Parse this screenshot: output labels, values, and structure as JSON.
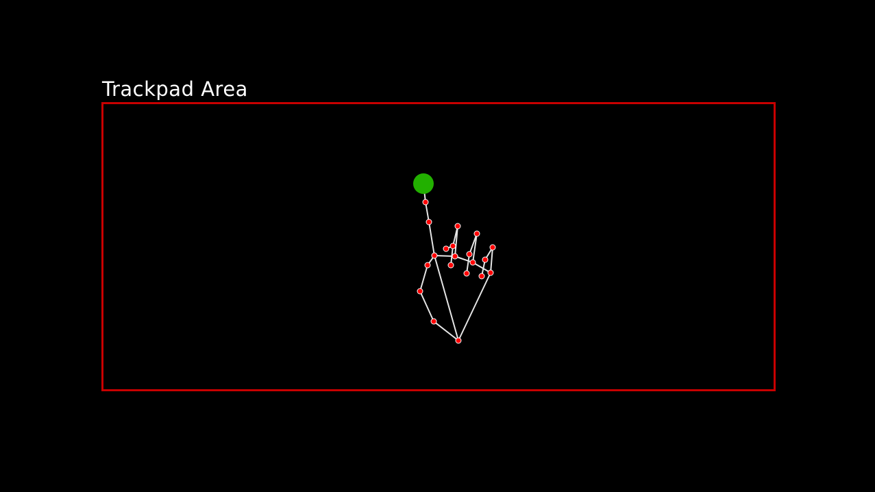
{
  "trackpad": {
    "label": "Trackpad Area"
  },
  "colors": {
    "background": "#000000",
    "trackpad_border": "#c80000",
    "skeleton_line": "#e6e6e6",
    "landmark_point": "#ff0000",
    "cursor": "#22b000"
  },
  "icons": {
    "cursor": "green-cursor-dot"
  }
}
